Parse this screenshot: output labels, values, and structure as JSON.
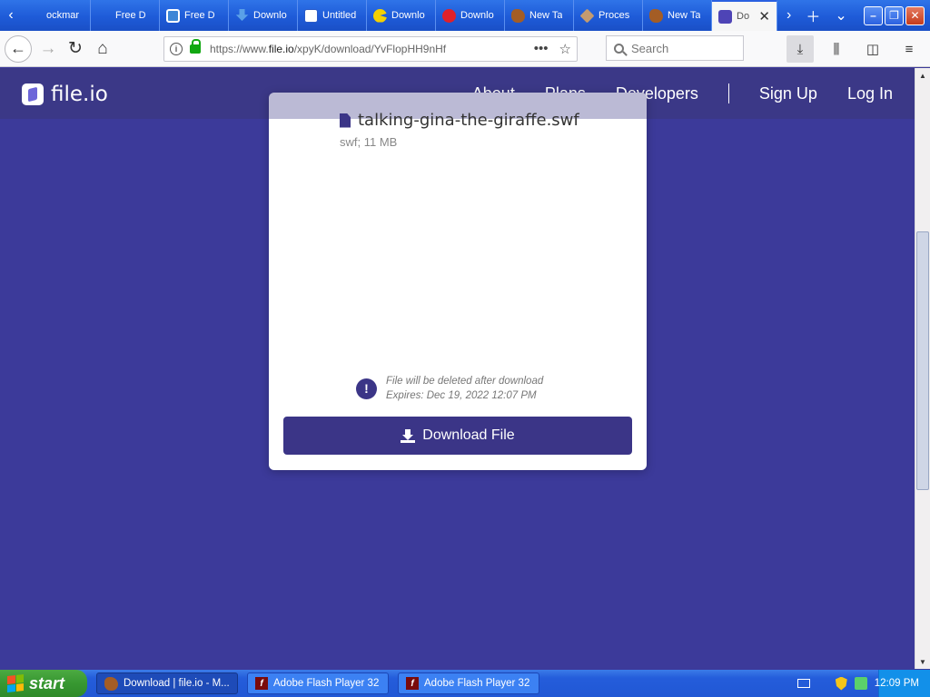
{
  "browser": {
    "tabs": [
      {
        "label": "ockmar",
        "icon": "blank-icon"
      },
      {
        "label": "Free D",
        "icon": "blank-icon"
      },
      {
        "label": "Free D",
        "icon": "monitor-icon"
      },
      {
        "label": "Downlo",
        "icon": "download-icon"
      },
      {
        "label": "Untitled",
        "icon": "document-icon"
      },
      {
        "label": "Downlo",
        "icon": "pacman-icon"
      },
      {
        "label": "Downlo",
        "icon": "red-circle-icon"
      },
      {
        "label": "New Ta",
        "icon": "bird-icon"
      },
      {
        "label": "Proces",
        "icon": "diamond-icon"
      },
      {
        "label": "New Ta",
        "icon": "bird-icon"
      },
      {
        "label": "Do",
        "icon": "fileio-icon",
        "active": true
      }
    ],
    "url": {
      "prefix": "https://www.",
      "domain": "file.io",
      "path": "/xpyK/download/YvFlopHH9nHf"
    },
    "search_placeholder": "Search"
  },
  "site": {
    "logo": "file.io",
    "nav": {
      "about": "About",
      "plans": "Plans",
      "developers": "Developers",
      "signup": "Sign Up",
      "login": "Log In"
    },
    "file": {
      "name": "talking-gina-the-giraffe.swf",
      "meta": "swf; 11 MB"
    },
    "notice": {
      "line1": "File will be deleted after download",
      "line2": "Expires: Dec 19, 2022 12:07 PM"
    },
    "download_button": "Download File"
  },
  "taskbar": {
    "start": "start",
    "items": [
      {
        "label": "Download | file.io - M..."
      },
      {
        "label": "Adobe Flash Player 32"
      },
      {
        "label": "Adobe Flash Player 32"
      }
    ],
    "clock": "12:09 PM"
  },
  "colors": {
    "page_bg": "#3c3a9a",
    "header_bg": "#3b3887",
    "accent": "#3b3587"
  }
}
